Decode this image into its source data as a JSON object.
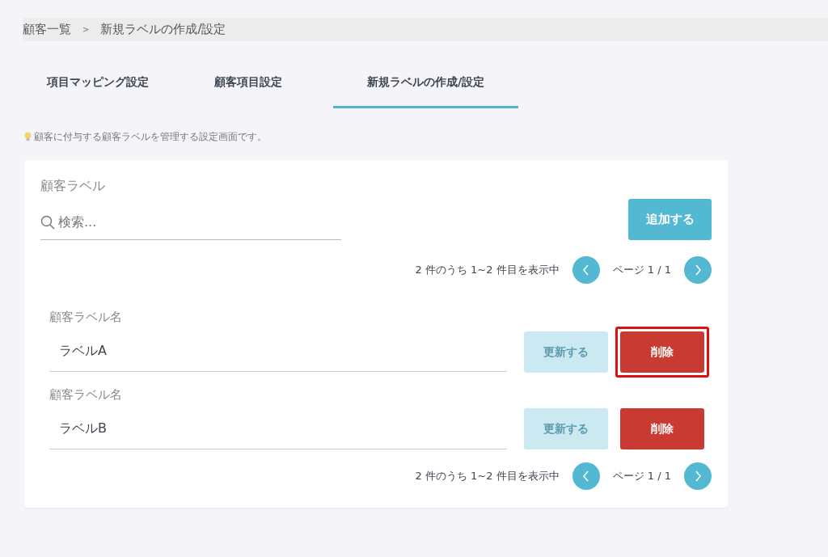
{
  "breadcrumb": [
    "顧客一覧",
    "新規ラベルの作成/設定"
  ],
  "breadcrumb_separator": ">",
  "tabs": [
    {
      "label": "項目マッピング設定",
      "selected": false
    },
    {
      "label": "顧客項目設定",
      "selected": false
    },
    {
      "label": "新規ラベルの作成/設定",
      "selected": true
    }
  ],
  "hint": "顧客に付与する顧客ラベルを管理する設定画面です。",
  "card": {
    "title": "顧客ラベル",
    "search": {
      "placeholder": "検索..."
    },
    "add_button": "追加する",
    "pagination_top": {
      "summary": "2 件のうち 1~2 件目を表示中",
      "page": "ページ 1 / 1"
    },
    "labels": [
      {
        "field_label": "顧客ラベル名",
        "value": "ラベルA",
        "update_button": "更新する",
        "update_disabled": true,
        "delete_button": "削除",
        "highlighted": true
      },
      {
        "field_label": "顧客ラベル名",
        "value": "ラベルB",
        "update_button": "更新する",
        "update_disabled": true,
        "delete_button": "削除",
        "highlighted": false
      }
    ],
    "pagination_bottom": {
      "summary": "2 件のうち 1~2 件目を表示中",
      "page": "ページ 1 / 1"
    }
  }
}
